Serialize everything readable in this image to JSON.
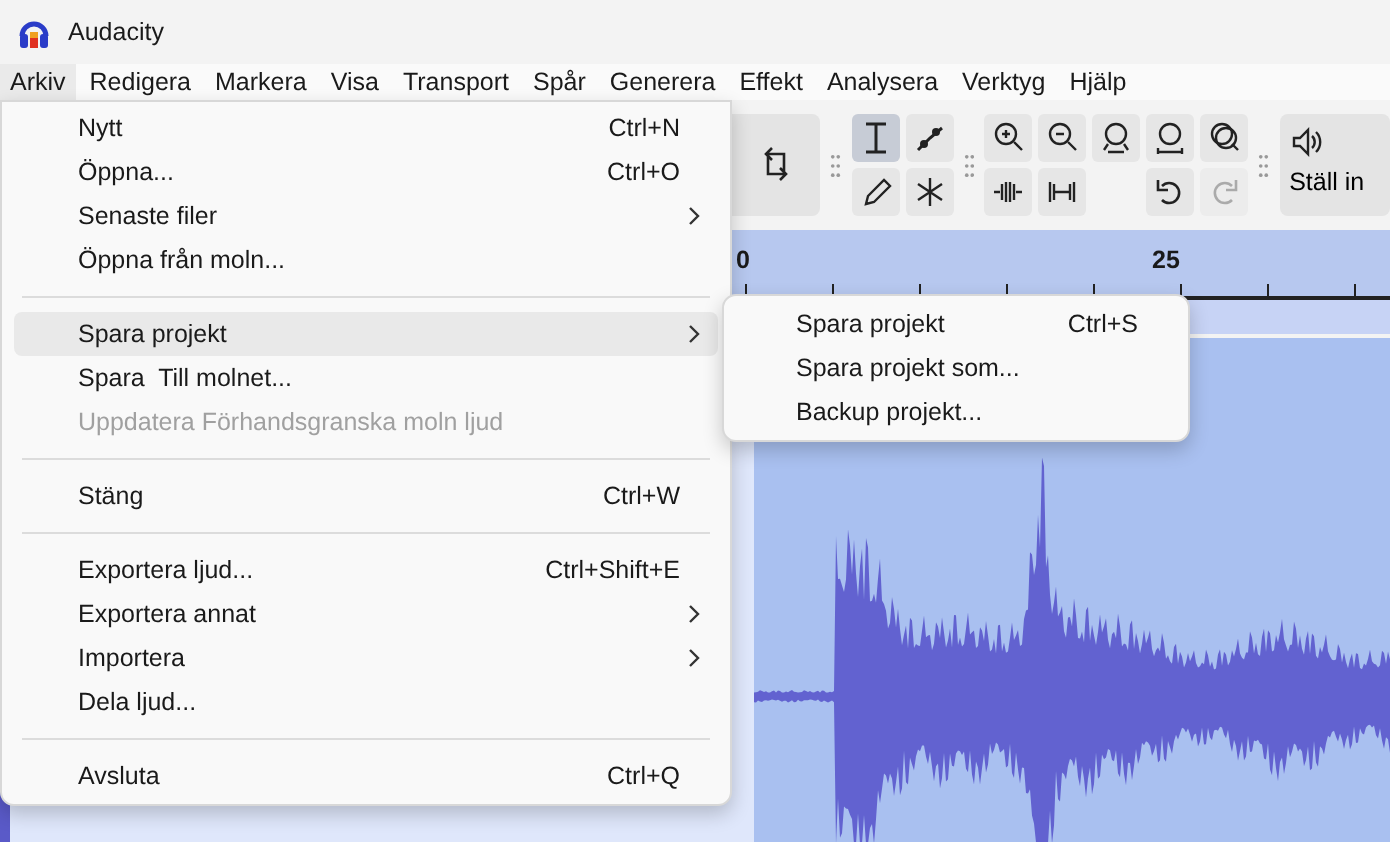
{
  "window": {
    "title": "Audacity"
  },
  "menubar": [
    {
      "label": "Arkiv",
      "selected": true
    },
    {
      "label": "Redigera",
      "selected": false
    },
    {
      "label": "Markera",
      "selected": false
    },
    {
      "label": "Visa",
      "selected": false
    },
    {
      "label": "Transport",
      "selected": false
    },
    {
      "label": "Spår",
      "selected": false
    },
    {
      "label": "Generera",
      "selected": false
    },
    {
      "label": "Effekt",
      "selected": false
    },
    {
      "label": "Analysera",
      "selected": false
    },
    {
      "label": "Verktyg",
      "selected": false
    },
    {
      "label": "Hjälp",
      "selected": false
    }
  ],
  "toolbar": {
    "tools": [
      {
        "kind": "select",
        "selected": true
      },
      {
        "kind": "envelope",
        "selected": false
      },
      {
        "kind": "draw",
        "selected": false
      },
      {
        "kind": "multi",
        "selected": false
      }
    ],
    "edit_buttons": [
      {
        "kind": "zoom-in",
        "disabled": false
      },
      {
        "kind": "zoom-out",
        "disabled": false
      },
      {
        "kind": "fit-selection",
        "disabled": false
      },
      {
        "kind": "fit-project",
        "disabled": false
      },
      {
        "kind": "zoom-toggle",
        "disabled": false
      },
      {
        "kind": "trim",
        "disabled": false
      },
      {
        "kind": "silence",
        "disabled": false
      },
      {
        "kind": "undo",
        "disabled": false
      },
      {
        "kind": "redo",
        "disabled": true
      }
    ],
    "audio_setup": {
      "label": "Ställ in"
    }
  },
  "ruler": {
    "labels": [
      "0",
      "25"
    ]
  },
  "file_menu": {
    "items": [
      {
        "kind": "item",
        "label": "Nytt",
        "shortcut": "Ctrl+N",
        "submenu": false,
        "disabled": false,
        "selected": false
      },
      {
        "kind": "item",
        "label": "Öppna...",
        "shortcut": "Ctrl+O",
        "submenu": false,
        "disabled": false,
        "selected": false
      },
      {
        "kind": "item",
        "label": "Senaste filer",
        "submenu": true,
        "disabled": false,
        "selected": false
      },
      {
        "kind": "item",
        "label": "Öppna från moln...",
        "submenu": false,
        "disabled": false,
        "selected": false
      },
      {
        "kind": "separator"
      },
      {
        "kind": "item",
        "label": "Spara projekt",
        "submenu": true,
        "disabled": false,
        "selected": true
      },
      {
        "kind": "item",
        "label": "Spara  Till molnet...",
        "submenu": false,
        "disabled": false,
        "selected": false
      },
      {
        "kind": "item",
        "label": "Uppdatera Förhandsgranska moln ljud",
        "submenu": false,
        "disabled": true,
        "selected": false
      },
      {
        "kind": "separator"
      },
      {
        "kind": "item",
        "label": "Stäng",
        "shortcut": "Ctrl+W",
        "submenu": false,
        "disabled": false,
        "selected": false
      },
      {
        "kind": "separator"
      },
      {
        "kind": "item",
        "label": "Exportera ljud...",
        "shortcut": "Ctrl+Shift+E",
        "submenu": false,
        "disabled": false,
        "selected": false
      },
      {
        "kind": "item",
        "label": "Exportera annat",
        "submenu": true,
        "disabled": false,
        "selected": false
      },
      {
        "kind": "item",
        "label": "Importera",
        "submenu": true,
        "disabled": false,
        "selected": false
      },
      {
        "kind": "item",
        "label": "Dela ljud...",
        "submenu": false,
        "disabled": false,
        "selected": false
      },
      {
        "kind": "separator"
      },
      {
        "kind": "item",
        "label": "Avsluta",
        "shortcut": "Ctrl+Q",
        "submenu": false,
        "disabled": false,
        "selected": false
      }
    ]
  },
  "save_submenu": {
    "items": [
      {
        "label": "Spara projekt",
        "shortcut": "Ctrl+S"
      },
      {
        "label": "Spara projekt som..."
      },
      {
        "label": "Backup projekt..."
      }
    ]
  }
}
